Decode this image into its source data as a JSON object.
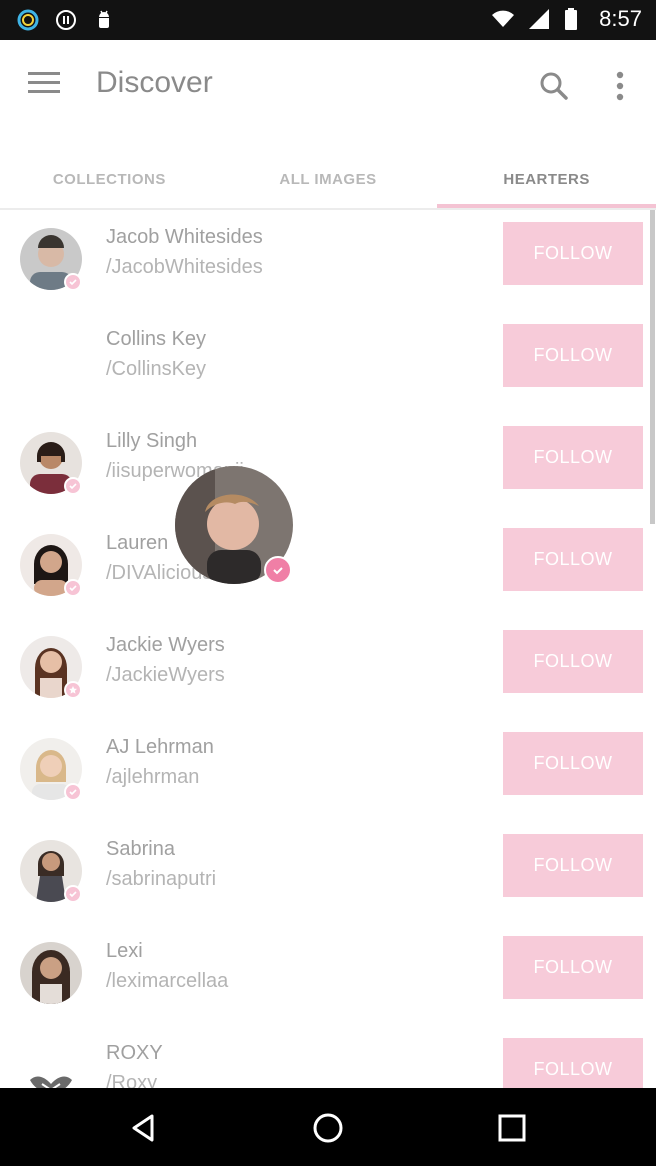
{
  "status_bar": {
    "time": "8:57"
  },
  "app_bar": {
    "title": "Discover"
  },
  "tabs": [
    {
      "label": "COLLECTIONS",
      "active": false
    },
    {
      "label": "ALL IMAGES",
      "active": false
    },
    {
      "label": "HEARTERS",
      "active": true
    }
  ],
  "colors": {
    "accent_pink": "#f7cbd9",
    "badge_pink": "#f07fa6"
  },
  "list": [
    {
      "name": "Jacob Whitesides",
      "handle": "/JacobWhitesides",
      "follow": "FOLLOW",
      "badge": "check"
    },
    {
      "name": "Collins Key",
      "handle": "/CollinsKey",
      "follow": "FOLLOW",
      "badge": ""
    },
    {
      "name": "Lilly Singh",
      "handle": "/iisuperwomanii",
      "follow": "FOLLOW",
      "badge": "check"
    },
    {
      "name": "Lauren",
      "handle": "/DIVAliciousKP",
      "follow": "FOLLOW",
      "badge": "check"
    },
    {
      "name": "Jackie Wyers",
      "handle": "/JackieWyers",
      "follow": "FOLLOW",
      "badge": "star"
    },
    {
      "name": "AJ Lehrman",
      "handle": "/ajlehrman",
      "follow": "FOLLOW",
      "badge": "check"
    },
    {
      "name": "Sabrina",
      "handle": "/sabrinaputri",
      "follow": "FOLLOW",
      "badge": "check"
    },
    {
      "name": "Lexi",
      "handle": "/leximarcellaa",
      "follow": "FOLLOW",
      "badge": ""
    },
    {
      "name": "ROXY",
      "handle": "/Roxy",
      "follow": "FOLLOW",
      "badge": ""
    }
  ]
}
